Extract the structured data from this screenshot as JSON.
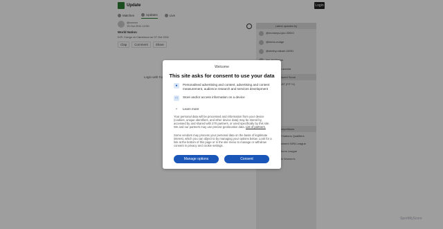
{
  "app": {
    "title": "Update",
    "login_label": "Login"
  },
  "tabs": [
    {
      "label": "Matches"
    },
    {
      "label": "Updates"
    },
    {
      "label": "Live"
    }
  ],
  "post": {
    "user": "@vvvvvv",
    "timestamp": "19 Oct 2011 12:50",
    "title": "World Nation",
    "body": "D.R. Congo vs Cameroon on 07 Oct 2011",
    "actions": {
      "clap": "Clap",
      "comment": "Comment",
      "share": "Share"
    }
  },
  "login_prompt": "Login with Fa",
  "sidebar": {
    "header": "Latest updates by",
    "rows": [
      "@monkeys-lyko.33510",
      "@fotelo-matge",
      "@shelby.mikael.15051",
      "ass.abullanga",
      "@oosthenga.aramla",
      "Featured Score",
      "September USE CAT (FIT+1)"
    ],
    "teams": [
      "Ittys",
      "Togo",
      "Rwanda",
      "Nigeria"
    ],
    "bottom": [
      "Czech",
      "England",
      "Competitions",
      "2027 Africa Cup of Nations Qualifiers",
      "2026 Cheers Investment NIFA League",
      "2026-27 UEFA Nations League",
      "2026 National Bank Women's"
    ]
  },
  "consent": {
    "welcome": "Welcome",
    "title": "This site asks for consent to use your data",
    "purposes": [
      {
        "icon": "person-icon",
        "text": "Personalised advertising and content, advertising and content measurement, audience research and services development"
      },
      {
        "icon": "device-icon",
        "text": "Store and/or access information on a device"
      }
    ],
    "learn_more": "Learn more",
    "para1": "Your personal data will be processed and information from your device (cookies, unique identifiers, and other device data) may be stored by, accessed by and shared with 270 partners, or used specifically by this site. We and our partners may use precise geolocation data.",
    "list_link": "List of partners.",
    "para2": "Some vendors may process your personal data on the basis of legitimate interest, which you can object to by managing your options below. Look for a link at the bottom of this page or in the site menu to manage or withdraw consent in privacy and cookie settings.",
    "manage_label": "Manage options",
    "consent_label": "Consent"
  },
  "watermark": "SportMyScore"
}
